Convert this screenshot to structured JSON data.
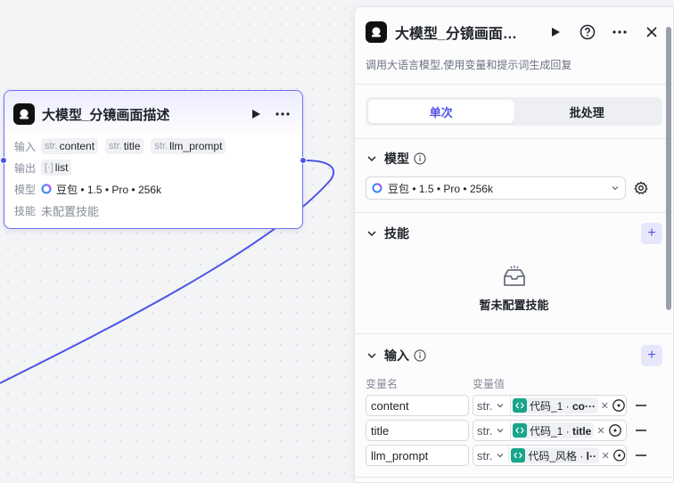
{
  "node": {
    "title": "大模型_分镜画面描述",
    "input_label": "输入",
    "output_label": "输出",
    "model_label": "模型",
    "skill_label": "技能",
    "inputs": [
      {
        "type": "str.",
        "name": "content"
      },
      {
        "type": "str.",
        "name": "title"
      },
      {
        "type": "str.",
        "name": "llm_prompt"
      }
    ],
    "output": {
      "type": "[⁠·⁠]",
      "name": "list"
    },
    "model_value": "豆包 • 1.5 • Pro • 256k",
    "skill_value": "未配置技能"
  },
  "panel": {
    "title": "大模型_分镜画面…",
    "description": "调用大语言模型,使用变量和提示词生成回复",
    "tabs": [
      {
        "label": "单次",
        "active": true
      },
      {
        "label": "批处理",
        "active": false
      }
    ],
    "model_section": {
      "title": "模型",
      "value": "豆包 • 1.5 • Pro • 256k"
    },
    "skills_section": {
      "title": "技能",
      "empty_text": "暂未配置技能"
    },
    "input_section": {
      "title": "输入",
      "col_name": "变量名",
      "col_value": "变量值",
      "rows": [
        {
          "name": "content",
          "type": "str.",
          "ref_prefix": "代码_1 · ",
          "ref_field": "co···"
        },
        {
          "name": "title",
          "type": "str.",
          "ref_prefix": "代码_1 · ",
          "ref_field": "title"
        },
        {
          "name": "llm_prompt",
          "type": "str.",
          "ref_prefix": "代码_风格 · ",
          "ref_field": "l···"
        }
      ]
    }
  },
  "colors": {
    "accent": "#4d53e8",
    "code_node": "#18a58a",
    "wire": "#4d53e8"
  }
}
